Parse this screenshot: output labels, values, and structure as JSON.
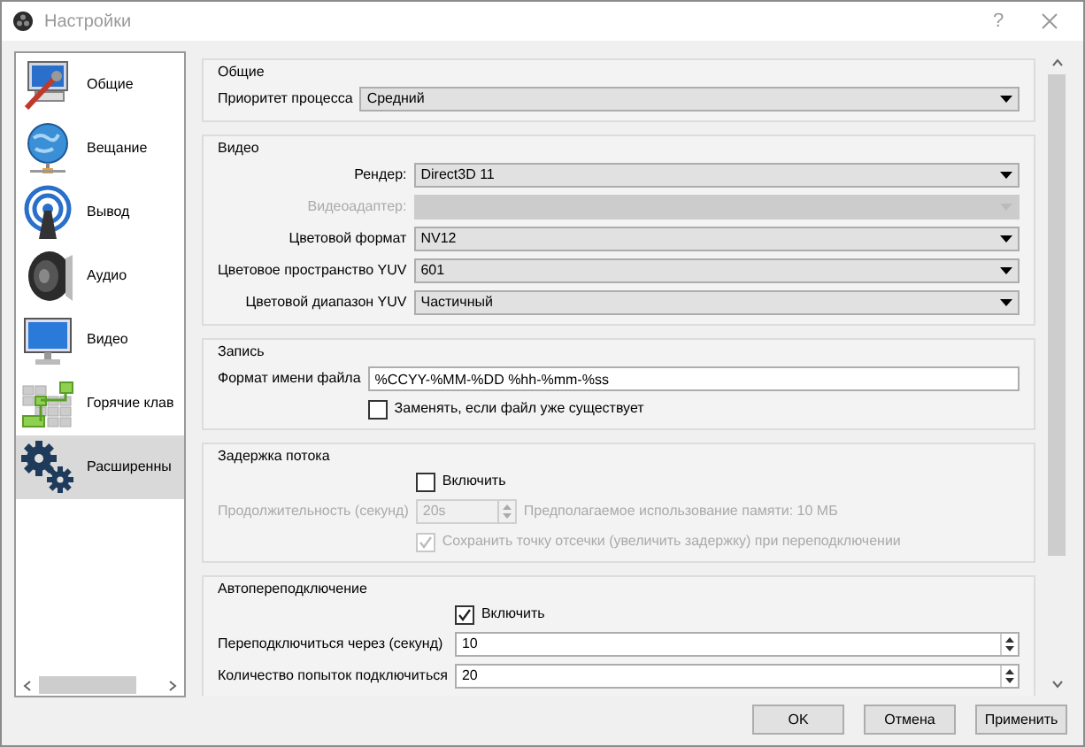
{
  "window": {
    "title": "Настройки",
    "help": "?"
  },
  "sidebar": {
    "items": [
      {
        "label": "Общие",
        "kind": "general",
        "selected": false
      },
      {
        "label": "Вещание",
        "kind": "stream",
        "selected": false
      },
      {
        "label": "Вывод",
        "kind": "output",
        "selected": false
      },
      {
        "label": "Аудио",
        "kind": "audio",
        "selected": false
      },
      {
        "label": "Видео",
        "kind": "video",
        "selected": false
      },
      {
        "label": "Горячие клав",
        "kind": "hotkeys",
        "selected": false
      },
      {
        "label": "Расширенны",
        "kind": "advanced",
        "selected": true
      }
    ]
  },
  "sections": [
    {
      "title": "Общие",
      "rows": [
        {
          "kind": "combo",
          "label": "Приоритет процесса",
          "value": "Средний",
          "disabled": false
        }
      ]
    },
    {
      "title": "Видео",
      "labels_right_aligned": true,
      "rows": [
        {
          "kind": "combo",
          "label": "Рендер:",
          "value": "Direct3D 11",
          "disabled": false
        },
        {
          "kind": "combo",
          "label": "Видеоадаптер:",
          "disabled": true
        },
        {
          "kind": "combo",
          "label": "Цветовой формат",
          "value": "NV12",
          "disabled": false
        },
        {
          "kind": "combo",
          "label": "Цветовое пространство YUV",
          "value": "601",
          "disabled": false
        },
        {
          "kind": "combo",
          "label": "Цветовой диапазон YUV",
          "value": "Частичный",
          "disabled": false
        }
      ]
    },
    {
      "title": "Запись",
      "rows": [
        {
          "kind": "field",
          "label": "Формат имени файла",
          "value": "%CCYY-%MM-%DD %hh-%mm-%ss"
        },
        {
          "kind": "checkbox",
          "label": "Заменять, если файл уже существует",
          "checked": false,
          "disabled": false
        }
      ]
    },
    {
      "title": "Задержка потока",
      "rows": [
        {
          "kind": "checkbox",
          "label": "Включить",
          "checked": false,
          "disabled": false
        },
        {
          "kind": "spin",
          "label": "Продолжительность (секунд)",
          "value": "20s",
          "note": "Предполагаемое использование памяти: 10 МБ",
          "disabled": true
        },
        {
          "kind": "checkbox",
          "label": "Сохранить точку отсечки (увеличить задержку) при переподключении",
          "checked": true,
          "disabled": true
        }
      ]
    },
    {
      "title": "Автопереподключение",
      "labels_right_aligned": false,
      "rows": [
        {
          "kind": "checkbox",
          "label": "Включить",
          "checked": true,
          "disabled": false
        },
        {
          "kind": "spin",
          "label": "Переподключиться через (секунд)",
          "value": "10",
          "disabled": false
        },
        {
          "kind": "spin",
          "label": "Количество попыток подключиться",
          "value": "20",
          "disabled": false
        }
      ]
    }
  ],
  "buttons": [
    "OK",
    "Отмена",
    "Применить"
  ]
}
